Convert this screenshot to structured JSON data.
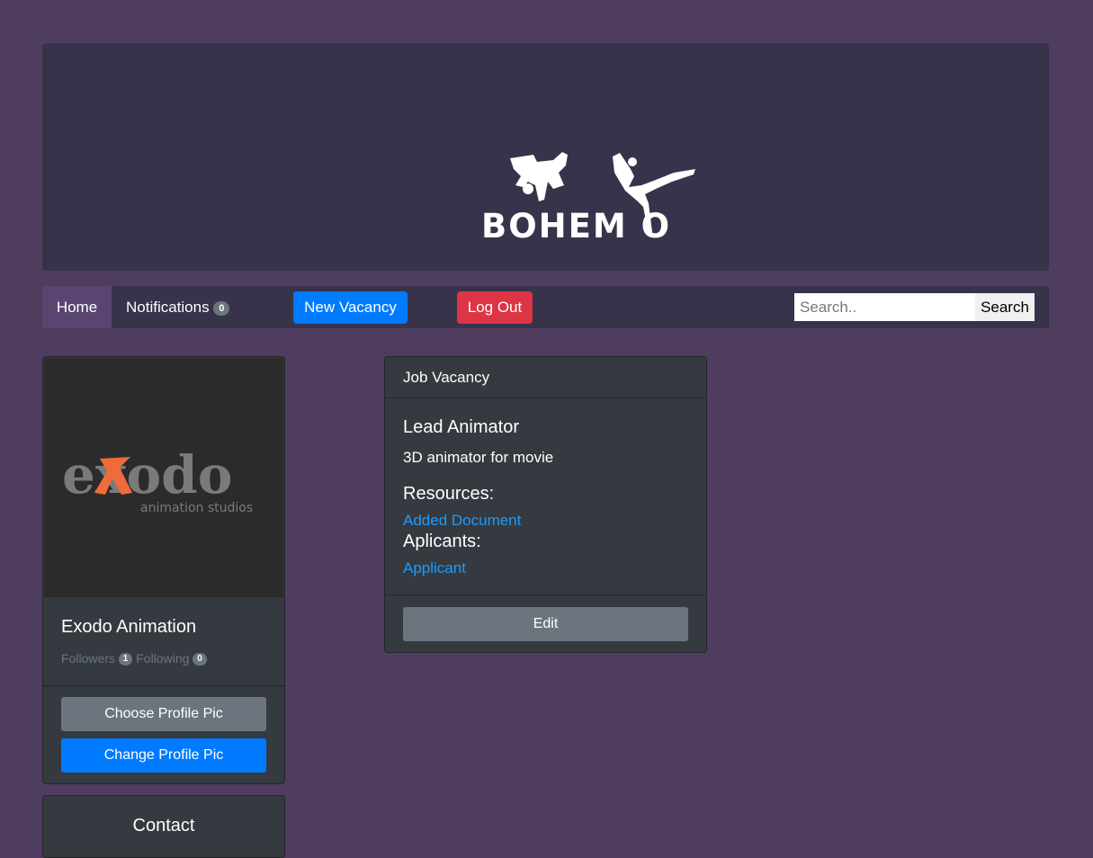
{
  "banner": {
    "logo_text": "BOHEM O"
  },
  "nav": {
    "home": "Home",
    "notifications": "Notifications",
    "notifications_count": "0",
    "new_vacancy": "New Vacancy",
    "logout": "Log Out",
    "search_placeholder": "Search..",
    "search_button": "Search"
  },
  "profile": {
    "logo_word": "exodo",
    "logo_sub": "animation studios",
    "name": "Exodo Animation",
    "followers_label": "Followers",
    "followers_count": "1",
    "following_label": "Following",
    "following_count": "0",
    "choose_pic": "Choose Profile Pic",
    "change_pic": "Change Profile Pic"
  },
  "contact": {
    "title": "Contact"
  },
  "vacancy": {
    "header": "Job Vacancy",
    "title": "Lead Animator",
    "description": "3D animator for movie",
    "resources_label": "Resources:",
    "document_link": "Added Document",
    "applicants_label": "Aplicants:",
    "applicant_link": "Applicant",
    "edit": "Edit"
  },
  "colors": {
    "page_bg": "#4f3d5f",
    "banner_bg": "#38324a",
    "card_bg": "#343a40",
    "primary": "#007bff",
    "danger": "#dc3545",
    "secondary": "#6c757d",
    "link": "#1e9bff",
    "exodo_orange": "#ef6b3a"
  }
}
